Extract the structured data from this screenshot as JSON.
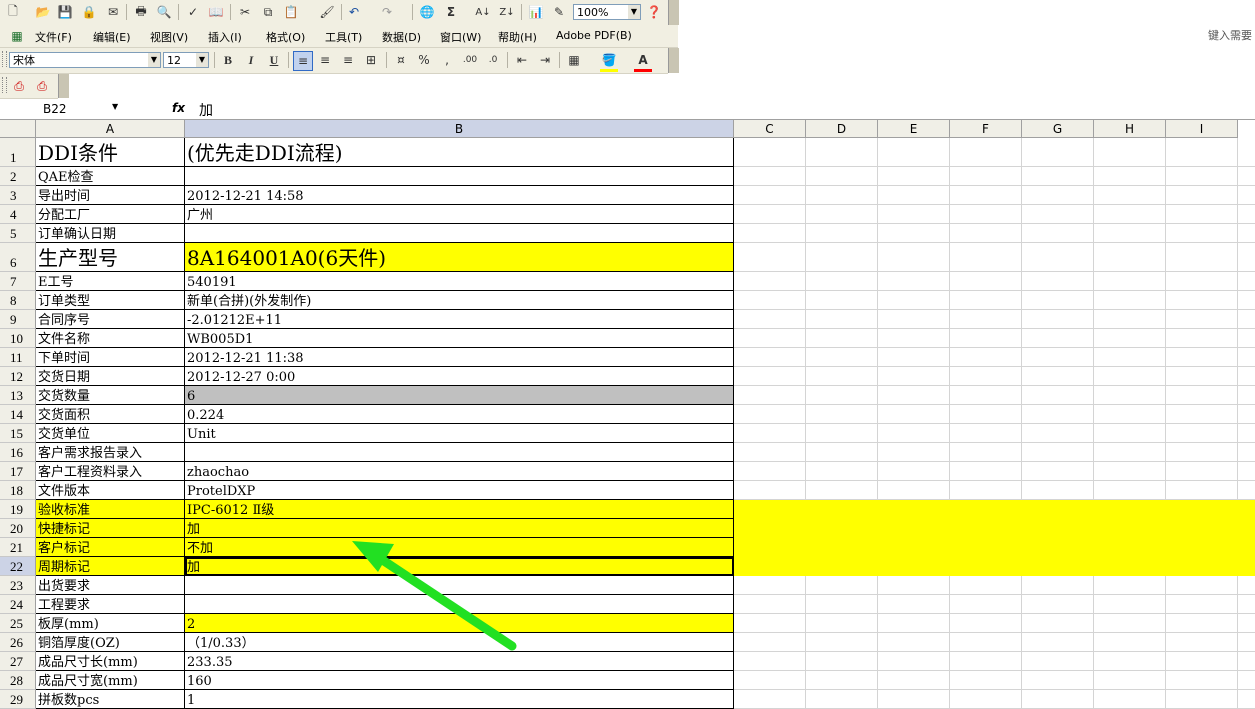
{
  "toolbar": {
    "zoom": "100%",
    "font_name": "宋体",
    "font_size": "12",
    "help_hint": "键入需要"
  },
  "menu": [
    "文件(F)",
    "编辑(E)",
    "视图(V)",
    "插入(I)",
    "格式(O)",
    "工具(T)",
    "数据(D)",
    "窗口(W)",
    "帮助(H)",
    "Adobe PDF(B)"
  ],
  "formula_bar": {
    "name_box": "B22",
    "fx": "fx",
    "content": "加"
  },
  "columns": [
    "A",
    "B",
    "C",
    "D",
    "E",
    "F",
    "G",
    "H",
    "I"
  ],
  "rows": [
    {
      "num": "1",
      "a": "DDI条件",
      "b": "(优先走DDI流程)"
    },
    {
      "num": "2",
      "a": "QAE检查",
      "b": ""
    },
    {
      "num": "3",
      "a": "导出时间",
      "b": "2012-12-21 14:58"
    },
    {
      "num": "4",
      "a": "分配工厂",
      "b": "广州"
    },
    {
      "num": "5",
      "a": "订单确认日期",
      "b": ""
    },
    {
      "num": "6",
      "a": "生产型号",
      "b": "8A164001A0(6天件)"
    },
    {
      "num": "7",
      "a": "E工号",
      "b": "540191"
    },
    {
      "num": "8",
      "a": "订单类型",
      "b": "新单(合拼)(外发制作)"
    },
    {
      "num": "9",
      "a": "合同序号",
      "b": "-2.01212E+11"
    },
    {
      "num": "10",
      "a": "文件名称",
      "b": "WB005D1"
    },
    {
      "num": "11",
      "a": "下单时间",
      "b": "2012-12-21 11:38"
    },
    {
      "num": "12",
      "a": "交货日期",
      "b": "2012-12-27 0:00"
    },
    {
      "num": "13",
      "a": "交货数量",
      "b": "6"
    },
    {
      "num": "14",
      "a": "交货面积",
      "b": "0.224"
    },
    {
      "num": "15",
      "a": "交货单位",
      "b": "Unit"
    },
    {
      "num": "16",
      "a": "客户需求报告录入",
      "b": ""
    },
    {
      "num": "17",
      "a": "客户工程资料录入",
      "b": "zhaochao"
    },
    {
      "num": "18",
      "a": "文件版本",
      "b": "ProtelDXP"
    },
    {
      "num": "19",
      "a": "验收标准",
      "b": "IPC-6012 Ⅱ级"
    },
    {
      "num": "20",
      "a": "快捷标记",
      "b": "加"
    },
    {
      "num": "21",
      "a": "客户标记",
      "b": "不加"
    },
    {
      "num": "22",
      "a": "周期标记",
      "b": "加"
    },
    {
      "num": "23",
      "a": "出货要求",
      "b": ""
    },
    {
      "num": "24",
      "a": "工程要求",
      "b": ""
    },
    {
      "num": "25",
      "a": "板厚(mm)",
      "b": "2"
    },
    {
      "num": "26",
      "a": "铜箔厚度(OZ)",
      "b": "（1/0.33）"
    },
    {
      "num": "27",
      "a": "成品尺寸长(mm)",
      "b": "233.35"
    },
    {
      "num": "28",
      "a": "成品尺寸宽(mm)",
      "b": "160"
    },
    {
      "num": "29",
      "a": "拼板数pcs",
      "b": "1"
    }
  ],
  "colors": {
    "highlight": "#ffff00",
    "arrow": "#22e022",
    "selected_header": "#ccd3e6"
  }
}
